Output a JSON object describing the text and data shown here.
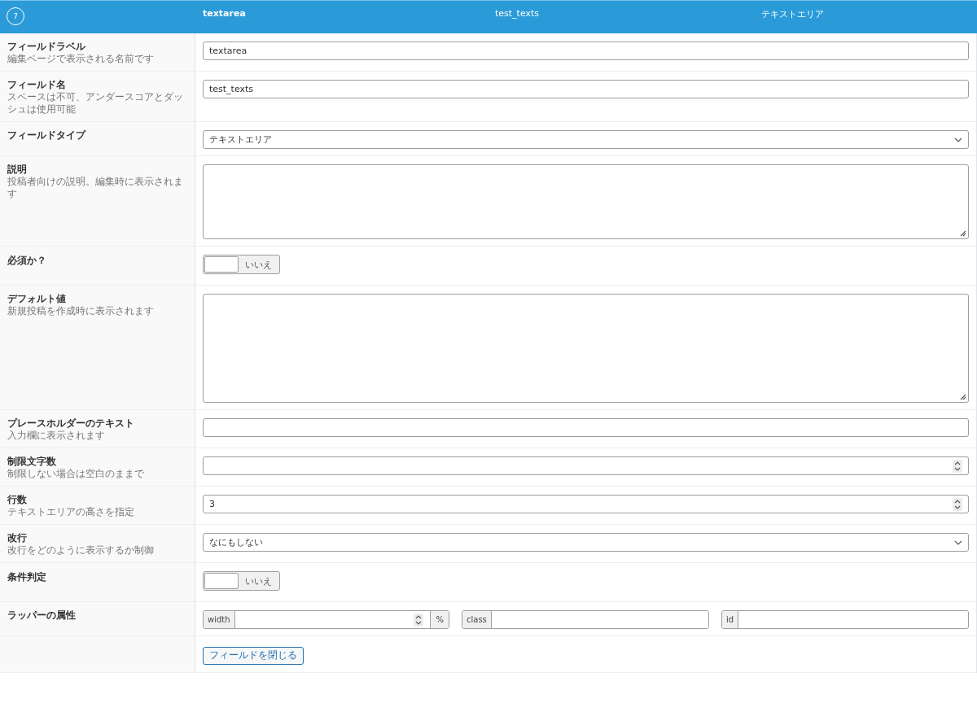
{
  "header": {
    "order": "7",
    "label": "textarea",
    "name": "test_texts",
    "type": "テキストエリア"
  },
  "rows": [
    {
      "kind": "text",
      "label": "フィールドラベル",
      "description": "編集ページで表示される名前です",
      "value": "textarea"
    },
    {
      "kind": "text",
      "label": "フィールド名",
      "description": "スペースは不可、アンダースコアとダッシュは使用可能",
      "value": "test_texts"
    },
    {
      "kind": "select",
      "label": "フィールドタイプ",
      "value": "テキストエリア"
    },
    {
      "kind": "textarea",
      "label": "説明",
      "description": "投稿者向けの説明。編集時に表示されます"
    },
    {
      "kind": "toggle",
      "label": "必須か？",
      "on": false,
      "toggle_label": "いいえ"
    },
    {
      "kind": "largetextarea",
      "label": "デフォルト値",
      "description": "新規投稿を作成時に表示されます"
    },
    {
      "kind": "text",
      "label": "プレースホルダーのテキスト",
      "description": "入力欄に表示されます"
    },
    {
      "kind": "number",
      "label": "制限文字数",
      "description": "制限しない場合は空白のままで"
    },
    {
      "kind": "number",
      "label": "行数",
      "description": "テキストエリアの高さを指定",
      "value": "3"
    },
    {
      "kind": "select",
      "label": "改行",
      "description": "改行をどのように表示するか制御",
      "value": "なにもしない"
    },
    {
      "kind": "toggle",
      "label": "条件判定",
      "on": false,
      "toggle_label": "いいえ"
    },
    {
      "kind": "wrapper",
      "label": "ラッパーの属性",
      "fields": [
        {
          "kind": "number",
          "prefix": "width",
          "suffix": "%"
        },
        {
          "kind": "text",
          "prefix": "class"
        },
        {
          "kind": "text",
          "prefix": "id"
        }
      ]
    },
    {
      "kind": "button",
      "button": "フィールドを閉じる"
    }
  ]
}
